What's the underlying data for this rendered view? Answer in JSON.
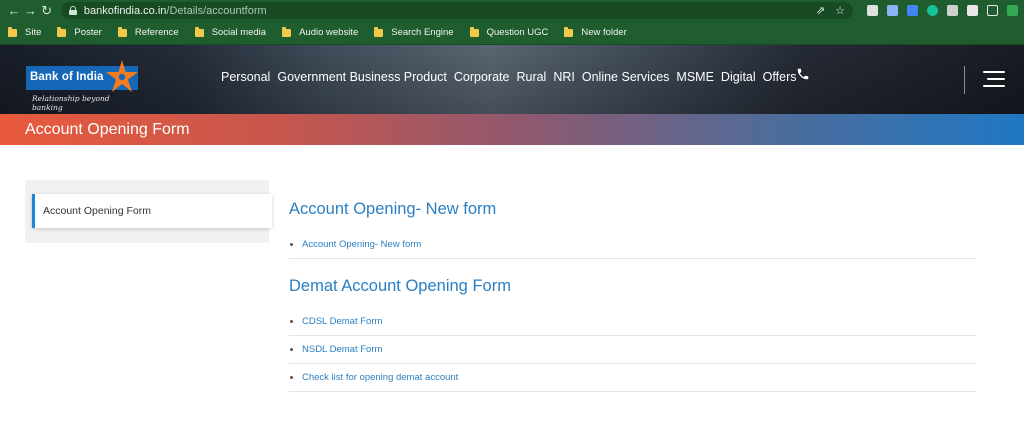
{
  "browser": {
    "url_domain": "bankofindia.co.in",
    "url_path": "/Details/accountform",
    "bookmarks": [
      "Site",
      "Poster",
      "Reference",
      "Social media",
      "Audio website",
      "Search Engine",
      "Question UGC",
      "New folder"
    ]
  },
  "header": {
    "logo_text": "Bank of India",
    "tagline": "Relationship beyond banking",
    "nav": [
      "Personal",
      "Government Business Product",
      "Corporate",
      "Rural",
      "NRI",
      "Online Services",
      "MSME",
      "Digital",
      "Offers"
    ]
  },
  "page": {
    "title": "Account Opening Form"
  },
  "sidebar": {
    "items": [
      {
        "label": "Account Opening Form"
      }
    ]
  },
  "sections": [
    {
      "title": "Account Opening- New form",
      "links": [
        "Account Opening- New form"
      ]
    },
    {
      "title": "Demat Account Opening Form",
      "links": [
        "CDSL Demat Form",
        "NSDL Demat Form",
        "Check list for opening demat account"
      ]
    }
  ],
  "colors": {
    "brand_blue": "#1468b7",
    "accent_orange": "#e85a3c",
    "link_blue": "#2a7fc2",
    "chrome_green": "#1f5c2e"
  }
}
